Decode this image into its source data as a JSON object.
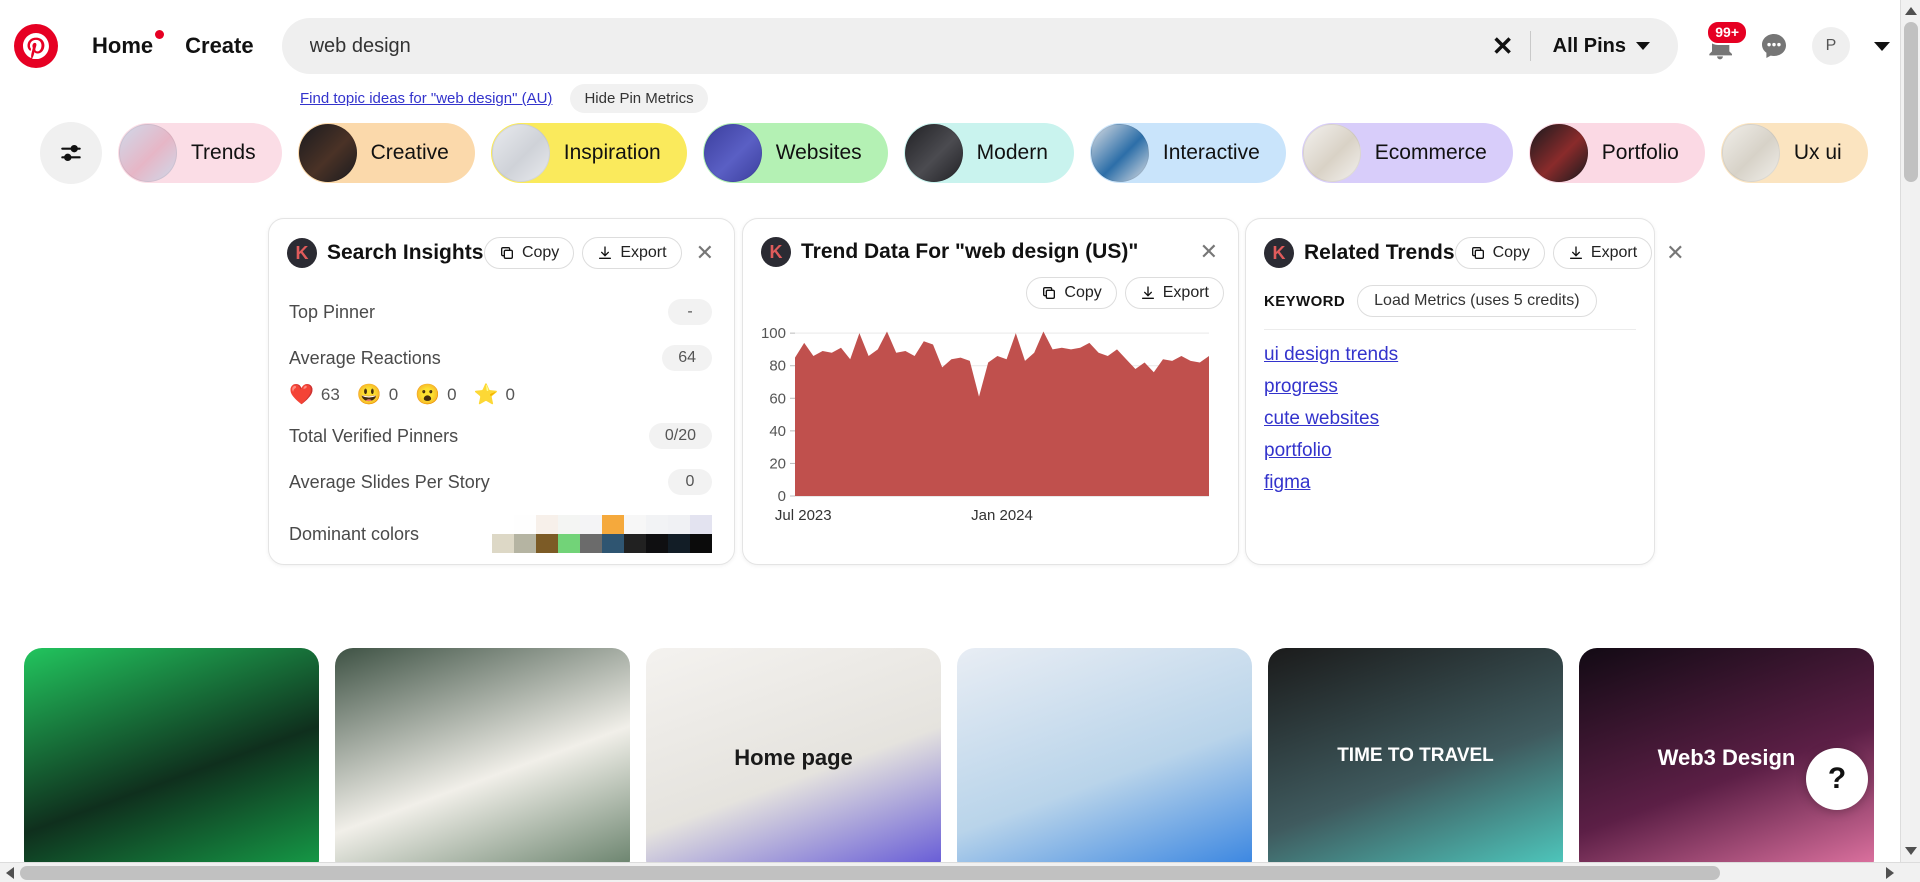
{
  "header": {
    "logo_icon": "pinterest-logo-icon",
    "home_label": "Home",
    "create_label": "Create",
    "search": {
      "value": "web design",
      "placeholder": "Search",
      "clear_icon": "close-icon"
    },
    "all_pins_label": "All Pins",
    "notifications": {
      "icon": "bell-icon",
      "badge": "99+"
    },
    "messages_icon": "chat-bubble-icon",
    "avatar_label": "P",
    "account_chevron_icon": "chevron-down-icon"
  },
  "undersearch": {
    "topic_link": "Find topic ideas for \"web design\" (AU)",
    "hide_metrics_label": "Hide Pin Metrics"
  },
  "chips": {
    "filter_icon": "sliders-icon",
    "items": [
      {
        "label": "Trends",
        "bg": "#fbdde6",
        "thumb1": "#cfd9ea",
        "thumb2": "#e6b6c6"
      },
      {
        "label": "Creative",
        "bg": "#fbd9ab",
        "thumb1": "#1b1b1f",
        "thumb2": "#4a3226"
      },
      {
        "label": "Inspiration",
        "bg": "#faea5c",
        "thumb1": "#e8eaee",
        "thumb2": "#cfd2d8"
      },
      {
        "label": "Websites",
        "bg": "#b4f1b4",
        "thumb1": "#3c3f9e",
        "thumb2": "#5a5fc4"
      },
      {
        "label": "Modern",
        "bg": "#c9f3ee",
        "thumb1": "#222226",
        "thumb2": "#4b4b50"
      },
      {
        "label": "Interactive",
        "bg": "#c9e4fb",
        "thumb1": "#d9dde3",
        "thumb2": "#2c6ea8"
      },
      {
        "label": "Ecommerce",
        "bg": "#d8cdfa",
        "thumb1": "#f3f1ee",
        "thumb2": "#d9d2c6"
      },
      {
        "label": "Portfolio",
        "bg": "#fbd9e4",
        "thumb1": "#1a1a1e",
        "thumb2": "#8a2b2b"
      },
      {
        "label": "Ux ui",
        "bg": "#fbe4c0",
        "thumb1": "#f0eee9",
        "thumb2": "#d7d2c8"
      }
    ]
  },
  "panels": {
    "copy_label": "Copy",
    "export_label": "Export",
    "copy_icon": "copy-icon",
    "export_icon": "download-icon",
    "close_icon": "close-icon",
    "brand_badge": "K",
    "insights": {
      "title": "Search Insights",
      "rows": [
        {
          "label": "Top Pinner",
          "value": "-"
        },
        {
          "label": "Average Reactions",
          "value": "64"
        },
        {
          "label": "Total Verified Pinners",
          "value": "0/20"
        },
        {
          "label": "Average Slides Per Story",
          "value": "0"
        }
      ],
      "reactions": [
        {
          "emoji": "❤️",
          "name": "heart-eyes-reaction-icon",
          "count": "63"
        },
        {
          "emoji": "😃",
          "name": "smile-reaction-icon",
          "count": "0"
        },
        {
          "emoji": "😮",
          "name": "surprised-reaction-icon",
          "count": "0"
        },
        {
          "emoji": "⭐",
          "name": "star-reaction-icon",
          "count": "0"
        }
      ],
      "dominant_colors_label": "Dominant colors",
      "dominant_colors_top": [
        "#ffffff",
        "#fefefe",
        "#f7f0ea",
        "#f4f5f3",
        "#f4f4f6",
        "#f5a93c",
        "#f7f7f7",
        "#f2f3f5",
        "#f0f1f4",
        "#e3e3f0"
      ],
      "dominant_colors_bottom": [
        "#ddd8c6",
        "#b5b4a2",
        "#7c5b26",
        "#72d378",
        "#6b6b6b",
        "#2f5571",
        "#212121",
        "#0f0f11",
        "#121d26",
        "#0b0b0b"
      ]
    },
    "trend": {
      "title": "Trend Data For \"web design (US)\""
    },
    "related": {
      "title": "Related Trends",
      "keyword_label": "KEYWORD",
      "load_metrics_label": "Load Metrics (uses 5 credits)",
      "links": [
        "ui design trends",
        "progress",
        "cute websites",
        "portfolio",
        "figma"
      ]
    }
  },
  "chart_data": {
    "type": "area",
    "title": "Trend Data For \"web design (US)\"",
    "xlabel": "",
    "ylabel": "",
    "ylim": [
      0,
      105
    ],
    "yticks": [
      0,
      20,
      40,
      60,
      80,
      100
    ],
    "grid": true,
    "legend": false,
    "color": "#c0504d",
    "xtick_labels": [
      "Jul 2023",
      "Jan 2024"
    ],
    "xtick_positions": [
      0.02,
      0.5
    ],
    "x": [
      "2023-07-02",
      "2023-07-09",
      "2023-07-16",
      "2023-07-23",
      "2023-07-30",
      "2023-08-06",
      "2023-08-13",
      "2023-08-20",
      "2023-08-27",
      "2023-09-03",
      "2023-09-10",
      "2023-09-17",
      "2023-09-24",
      "2023-10-01",
      "2023-10-08",
      "2023-10-15",
      "2023-10-22",
      "2023-10-29",
      "2023-11-05",
      "2023-11-12",
      "2023-11-19",
      "2023-11-26",
      "2023-12-03",
      "2023-12-10",
      "2023-12-17",
      "2023-12-24",
      "2023-12-31",
      "2024-01-07",
      "2024-01-14",
      "2024-01-21",
      "2024-01-28",
      "2024-02-04",
      "2024-02-11",
      "2024-02-18",
      "2024-02-25",
      "2024-03-03",
      "2024-03-10",
      "2024-03-17",
      "2024-03-24",
      "2024-03-31",
      "2024-04-07",
      "2024-04-14",
      "2024-04-21",
      "2024-04-28",
      "2024-05-05",
      "2024-05-12",
      "2024-05-19",
      "2024-05-26",
      "2024-06-02",
      "2024-06-09",
      "2024-06-16",
      "2024-06-23"
    ],
    "values": [
      85,
      94,
      86,
      89,
      88,
      91,
      84,
      100,
      86,
      90,
      101,
      88,
      89,
      86,
      95,
      93,
      79,
      84,
      85,
      83,
      61,
      82,
      86,
      84,
      100,
      83,
      88,
      101,
      90,
      91,
      90,
      91,
      94,
      88,
      86,
      90,
      84,
      78,
      82,
      76,
      84,
      83,
      86,
      83,
      82,
      86
    ],
    "series_name": "web design (US)"
  },
  "pins": [
    {
      "name": "pin-xenon-bank",
      "caption": "",
      "c1": "#22c55e",
      "c2": "#0f2f1d",
      "c3": "#16a34a"
    },
    {
      "name": "pin-furni-interior",
      "caption": "",
      "c1": "#3e5244",
      "c2": "#f1efe9",
      "c3": "#5f7a63"
    },
    {
      "name": "pin-home-page",
      "caption": "Home page",
      "c1": "#f4f2ef",
      "c2": "#e5e3de",
      "c3": "#5b4fd6"
    },
    {
      "name": "pin-magic-flight",
      "caption": "",
      "c1": "#e8edf4",
      "c2": "#b9d4ea",
      "c3": "#2f7fe0"
    },
    {
      "name": "pin-time-to-travel",
      "caption": "TIME TO TRAVEL",
      "c1": "#1b1b1b",
      "c2": "#3f5a5e",
      "c3": "#4fd1c5"
    },
    {
      "name": "pin-web3-agency",
      "caption": "Web3 Design",
      "c1": "#120a14",
      "c2": "#5c1f46",
      "c3": "#e879a7"
    }
  ],
  "help": {
    "label": "?",
    "icon": "question-mark-icon"
  }
}
